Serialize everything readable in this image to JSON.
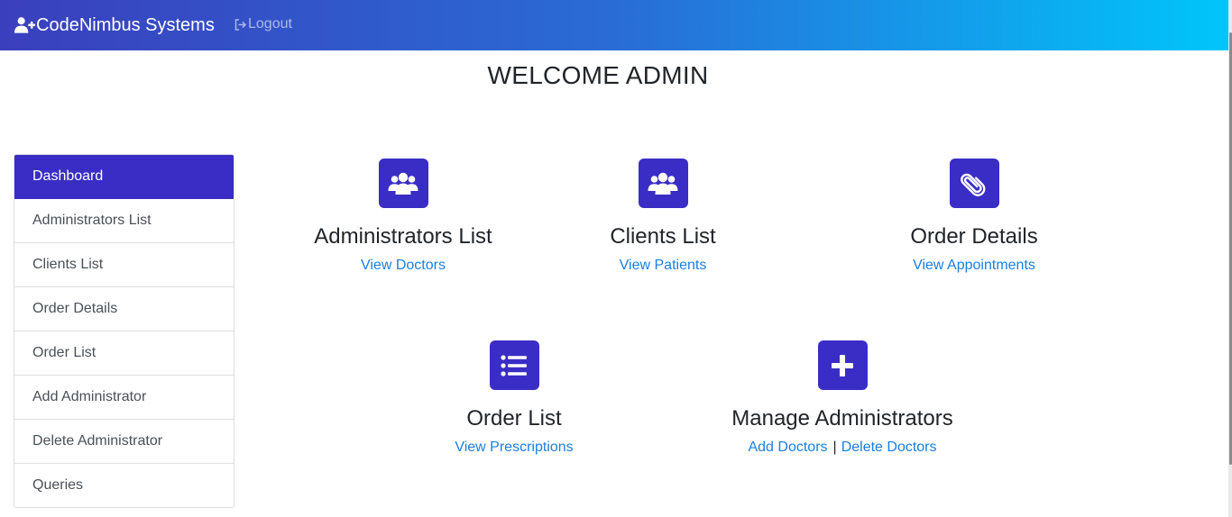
{
  "navbar": {
    "brand": "CodeNimbus Systems",
    "brand_icon": "user-plus-icon",
    "logout": "Logout",
    "logout_icon": "sign-out-icon"
  },
  "page": {
    "title": "WELCOME ADMIN"
  },
  "sidebar": {
    "items": [
      {
        "label": "Dashboard",
        "active": true
      },
      {
        "label": "Administrators List"
      },
      {
        "label": "Clients List"
      },
      {
        "label": "Order Details"
      },
      {
        "label": "Order List"
      },
      {
        "label": "Add Administrator"
      },
      {
        "label": "Delete Administrator"
      },
      {
        "label": "Queries"
      }
    ]
  },
  "cards": [
    {
      "icon": "users-icon",
      "title": "Administrators List",
      "links": [
        "View Doctors"
      ]
    },
    {
      "icon": "users-icon",
      "title": "Clients List",
      "links": [
        "View Patients"
      ]
    },
    {
      "icon": "paperclip-icon",
      "title": "Order Details",
      "links": [
        "View Appointments"
      ]
    },
    {
      "icon": "list-icon",
      "title": "Order List",
      "links": [
        "View Prescriptions"
      ]
    },
    {
      "icon": "plus-square-icon",
      "title": "Manage Administrators",
      "links": [
        "Add Doctors",
        "Delete Doctors"
      ],
      "separator": "|"
    }
  ],
  "colors": {
    "accent": "#3a2dc5",
    "link": "#1a7fe0",
    "nav_gradient_start": "#3a3fbd",
    "nav_gradient_end": "#00c6fb"
  }
}
